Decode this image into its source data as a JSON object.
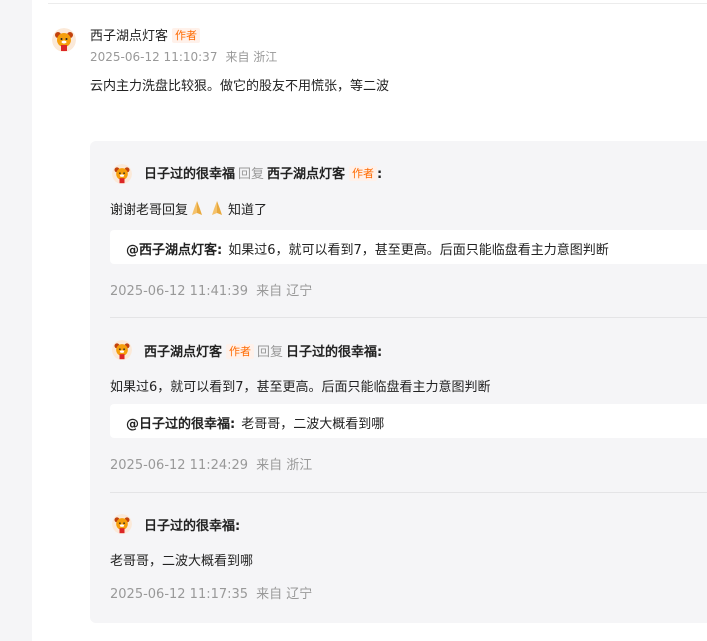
{
  "main_comment": {
    "user": "西子湖点灯客",
    "badge": "作者",
    "timestamp": "2025-06-12 11:10:37",
    "location": "来自 浙江",
    "text": "云内主力洗盘比较狠。做它的股友不用慌张，等二波"
  },
  "replies": [
    {
      "user": "日子过的很幸福",
      "reply_word": "回复",
      "reply_to": "西子湖点灯客",
      "reply_to_badge": "作者",
      "suffix": ":",
      "text_prefix": "谢谢老哥回复",
      "emoji": [
        "folded-hands-icon",
        "folded-hands-icon"
      ],
      "text_suffix": "知道了",
      "quote_at": "@西子湖点灯客:",
      "quote_text": "如果过6，就可以看到7，甚至更高。后面只能临盘看主力意图判断",
      "timestamp": "2025-06-12 11:41:39",
      "location": "来自 辽宁"
    },
    {
      "user": "西子湖点灯客",
      "badge": "作者",
      "reply_word": "回复",
      "reply_to": "日子过的很幸福:",
      "text": "如果过6，就可以看到7，甚至更高。后面只能临盘看主力意图判断",
      "quote_at": "@日子过的很幸福:",
      "quote_text": "老哥哥，二波大概看到哪",
      "timestamp": "2025-06-12 11:24:29",
      "location": "来自 浙江"
    },
    {
      "user": "日子过的很幸福:",
      "text": "老哥哥，二波大概看到哪",
      "timestamp": "2025-06-12 11:17:35",
      "location": "来自 辽宁"
    }
  ],
  "colors": {
    "badge_text": "#ff6a00",
    "badge_bg": "#fff1ea",
    "meta": "#999999",
    "reply_bg": "#f5f5f7"
  }
}
